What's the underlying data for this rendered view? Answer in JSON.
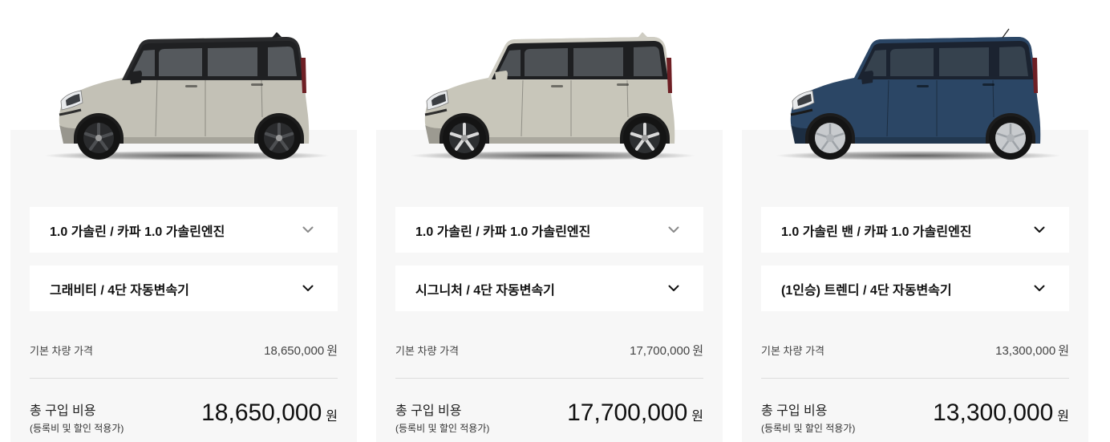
{
  "colors": {
    "page_background": "#ffffff",
    "card_background": "#f7f7f7",
    "select_background": "#ffffff",
    "divider": "#dddddd",
    "text_primary": "#111111",
    "text_secondary": "#444444"
  },
  "cards": [
    {
      "car": {
        "body_color": "#c3c1b6",
        "roof_color": "#2a2b2d",
        "pillar_color": "#1f2022",
        "window_color": "#55595d",
        "rim_color": "#2a2b2d",
        "spoke_color": "#4d4f52"
      },
      "engine": {
        "value": "1.0 가솔린 / 카파 1.0 가솔린엔진",
        "icon": "chevron-down-icon",
        "icon_color": "#8a8a8a"
      },
      "trim": {
        "value": "그래비티 / 4단 자동변속기",
        "icon": "chevron-down-icon",
        "icon_color": "#111111"
      },
      "base_price": {
        "label": "기본 차량 가격",
        "amount": "18,650,000",
        "unit": "원"
      },
      "total_price": {
        "label": "총 구입 비용",
        "note": "(등록비 및 할인 적용가)",
        "amount": "18,650,000",
        "unit": "원"
      }
    },
    {
      "car": {
        "body_color": "#c8c6ba",
        "roof_color": "#cfcdc3",
        "pillar_color": "#1e1f21",
        "window_color": "#4d5155",
        "rim_color": "#2d2f31",
        "spoke_color": "#dadada"
      },
      "engine": {
        "value": "1.0 가솔린 / 카파 1.0 가솔린엔진",
        "icon": "chevron-down-icon",
        "icon_color": "#8a8a8a"
      },
      "trim": {
        "value": "시그니처 / 4단 자동변속기",
        "icon": "chevron-down-icon",
        "icon_color": "#111111"
      },
      "base_price": {
        "label": "기본 차량 가격",
        "amount": "17,700,000",
        "unit": "원"
      },
      "total_price": {
        "label": "총 구입 비용",
        "note": "(등록비 및 할인 적용가)",
        "amount": "17,700,000",
        "unit": "원"
      }
    },
    {
      "car": {
        "body_color": "#2b4665",
        "roof_color": "#2b4665",
        "pillar_color": "#1b2330",
        "window_color": "#36424e",
        "rim_color": "#c8cbce",
        "spoke_color": "#9ea3a8"
      },
      "engine": {
        "value": "1.0 가솔린 밴 / 카파 1.0 가솔린엔진",
        "icon": "chevron-down-icon",
        "icon_color": "#111111"
      },
      "trim": {
        "value": "(1인승) 트렌디 / 4단 자동변속기",
        "icon": "chevron-down-icon",
        "icon_color": "#111111"
      },
      "base_price": {
        "label": "기본 차량 가격",
        "amount": "13,300,000",
        "unit": "원"
      },
      "total_price": {
        "label": "총 구입 비용",
        "note": "(등록비 및 할인 적용가)",
        "amount": "13,300,000",
        "unit": "원"
      }
    }
  ]
}
